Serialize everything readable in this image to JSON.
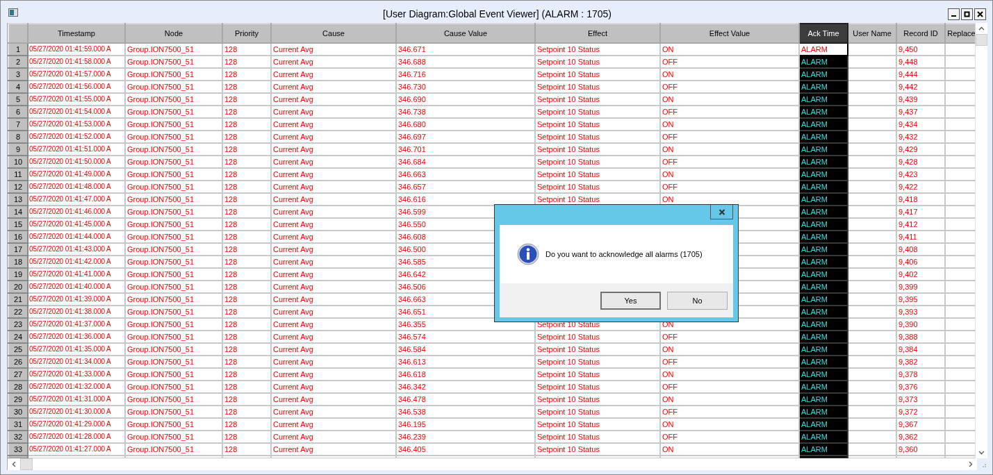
{
  "window": {
    "title": "[User Diagram:Global Event Viewer] (ALARM : 1705)"
  },
  "table": {
    "columns": [
      {
        "label": "Timestamp",
        "selected": false
      },
      {
        "label": "Node",
        "selected": false
      },
      {
        "label": "Priority",
        "selected": false
      },
      {
        "label": "Cause",
        "selected": false
      },
      {
        "label": "Cause Value",
        "selected": false
      },
      {
        "label": "Effect",
        "selected": false
      },
      {
        "label": "Effect Value",
        "selected": false
      },
      {
        "label": "Ack Time",
        "selected": true
      },
      {
        "label": "User Name",
        "selected": false
      },
      {
        "label": "Record ID",
        "selected": false
      },
      {
        "label": "Replace",
        "selected": false
      }
    ],
    "rows": [
      {
        "number": "1",
        "timestamp": "05/27/2020 01:41:59.000 A",
        "node": "Group.ION7500_51",
        "priority": "128",
        "cause": "Current Avg",
        "cause_value": "346.671",
        "effect": "Setpoint 10 Status",
        "effect_value": "ON",
        "ack_time": "ALARM",
        "selected": true,
        "record_id": "9,450"
      },
      {
        "number": "2",
        "timestamp": "05/27/2020 01:41:58.000 A",
        "node": "Group.ION7500_51",
        "priority": "128",
        "cause": "Current Avg",
        "cause_value": "346.688",
        "effect": "Setpoint 10 Status",
        "effect_value": "OFF",
        "ack_time": "ALARM",
        "selected": false,
        "record_id": "9,448"
      },
      {
        "number": "3",
        "timestamp": "05/27/2020 01:41:57.000 A",
        "node": "Group.ION7500_51",
        "priority": "128",
        "cause": "Current Avg",
        "cause_value": "346.716",
        "effect": "Setpoint 10 Status",
        "effect_value": "ON",
        "ack_time": "ALARM",
        "selected": false,
        "record_id": "9,444"
      },
      {
        "number": "4",
        "timestamp": "05/27/2020 01:41:56.000 A",
        "node": "Group.ION7500_51",
        "priority": "128",
        "cause": "Current Avg",
        "cause_value": "346.730",
        "effect": "Setpoint 10 Status",
        "effect_value": "OFF",
        "ack_time": "ALARM",
        "selected": false,
        "record_id": "9,442"
      },
      {
        "number": "5",
        "timestamp": "05/27/2020 01:41:55.000 A",
        "node": "Group.ION7500_51",
        "priority": "128",
        "cause": "Current Avg",
        "cause_value": "346.690",
        "effect": "Setpoint 10 Status",
        "effect_value": "ON",
        "ack_time": "ALARM",
        "selected": false,
        "record_id": "9,439"
      },
      {
        "number": "6",
        "timestamp": "05/27/2020 01:41:54.000 A",
        "node": "Group.ION7500_51",
        "priority": "128",
        "cause": "Current Avg",
        "cause_value": "346.738",
        "effect": "Setpoint 10 Status",
        "effect_value": "OFF",
        "ack_time": "ALARM",
        "selected": false,
        "record_id": "9,437"
      },
      {
        "number": "7",
        "timestamp": "05/27/2020 01:41:53.000 A",
        "node": "Group.ION7500_51",
        "priority": "128",
        "cause": "Current Avg",
        "cause_value": "346.680",
        "effect": "Setpoint 10 Status",
        "effect_value": "ON",
        "ack_time": "ALARM",
        "selected": false,
        "record_id": "9,434"
      },
      {
        "number": "8",
        "timestamp": "05/27/2020 01:41:52.000 A",
        "node": "Group.ION7500_51",
        "priority": "128",
        "cause": "Current Avg",
        "cause_value": "346.697",
        "effect": "Setpoint 10 Status",
        "effect_value": "OFF",
        "ack_time": "ALARM",
        "selected": false,
        "record_id": "9,432"
      },
      {
        "number": "9",
        "timestamp": "05/27/2020 01:41:51.000 A",
        "node": "Group.ION7500_51",
        "priority": "128",
        "cause": "Current Avg",
        "cause_value": "346.701",
        "effect": "Setpoint 10 Status",
        "effect_value": "ON",
        "ack_time": "ALARM",
        "selected": false,
        "record_id": "9,429"
      },
      {
        "number": "10",
        "timestamp": "05/27/2020 01:41:50.000 A",
        "node": "Group.ION7500_51",
        "priority": "128",
        "cause": "Current Avg",
        "cause_value": "346.684",
        "effect": "Setpoint 10 Status",
        "effect_value": "OFF",
        "ack_time": "ALARM",
        "selected": false,
        "record_id": "9,428"
      },
      {
        "number": "11",
        "timestamp": "05/27/2020 01:41:49.000 A",
        "node": "Group.ION7500_51",
        "priority": "128",
        "cause": "Current Avg",
        "cause_value": "346.663",
        "effect": "Setpoint 10 Status",
        "effect_value": "ON",
        "ack_time": "ALARM",
        "selected": false,
        "record_id": "9,423"
      },
      {
        "number": "12",
        "timestamp": "05/27/2020 01:41:48.000 A",
        "node": "Group.ION7500_51",
        "priority": "128",
        "cause": "Current Avg",
        "cause_value": "346.657",
        "effect": "Setpoint 10 Status",
        "effect_value": "OFF",
        "ack_time": "ALARM",
        "selected": false,
        "record_id": "9,422"
      },
      {
        "number": "13",
        "timestamp": "05/27/2020 01:41:47.000 A",
        "node": "Group.ION7500_51",
        "priority": "128",
        "cause": "Current Avg",
        "cause_value": "346.616",
        "effect": "Setpoint 10 Status",
        "effect_value": "ON",
        "ack_time": "ALARM",
        "selected": false,
        "record_id": "9,418"
      },
      {
        "number": "14",
        "timestamp": "05/27/2020 01:41:46.000 A",
        "node": "Group.ION7500_51",
        "priority": "128",
        "cause": "Current Avg",
        "cause_value": "346.599",
        "ack_time": "ALARM",
        "selected": false,
        "record_id": "9,417"
      },
      {
        "number": "15",
        "timestamp": "05/27/2020 01:41:45.000 A",
        "node": "Group.ION7500_51",
        "priority": "128",
        "cause": "Current Avg",
        "cause_value": "346.550",
        "ack_time": "ALARM",
        "selected": false,
        "record_id": "9,412"
      },
      {
        "number": "16",
        "timestamp": "05/27/2020 01:41:44.000 A",
        "node": "Group.ION7500_51",
        "priority": "128",
        "cause": "Current Avg",
        "cause_value": "346.608",
        "ack_time": "ALARM",
        "selected": false,
        "record_id": "9,411"
      },
      {
        "number": "17",
        "timestamp": "05/27/2020 01:41:43.000 A",
        "node": "Group.ION7500_51",
        "priority": "128",
        "cause": "Current Avg",
        "cause_value": "346.500",
        "ack_time": "ALARM",
        "selected": false,
        "record_id": "9,408"
      },
      {
        "number": "18",
        "timestamp": "05/27/2020 01:41:42.000 A",
        "node": "Group.ION7500_51",
        "priority": "128",
        "cause": "Current Avg",
        "cause_value": "346.585",
        "ack_time": "ALARM",
        "selected": false,
        "record_id": "9,406"
      },
      {
        "number": "19",
        "timestamp": "05/27/2020 01:41:41.000 A",
        "node": "Group.ION7500_51",
        "priority": "128",
        "cause": "Current Avg",
        "cause_value": "346.642",
        "ack_time": "ALARM",
        "selected": false,
        "record_id": "9,402"
      },
      {
        "number": "20",
        "timestamp": "05/27/2020 01:41:40.000 A",
        "node": "Group.ION7500_51",
        "priority": "128",
        "cause": "Current Avg",
        "cause_value": "346.506",
        "ack_time": "ALARM",
        "selected": false,
        "record_id": "9,399"
      },
      {
        "number": "21",
        "timestamp": "05/27/2020 01:41:39.000 A",
        "node": "Group.ION7500_51",
        "priority": "128",
        "cause": "Current Avg",
        "cause_value": "346.663",
        "ack_time": "ALARM",
        "selected": false,
        "record_id": "9,395"
      },
      {
        "number": "22",
        "timestamp": "05/27/2020 01:41:38.000 A",
        "node": "Group.ION7500_51",
        "priority": "128",
        "cause": "Current Avg",
        "cause_value": "346.651",
        "ack_time": "ALARM",
        "selected": false,
        "record_id": "9,393"
      },
      {
        "number": "23",
        "timestamp": "05/27/2020 01:41:37.000 A",
        "node": "Group.ION7500_51",
        "priority": "128",
        "cause": "Current Avg",
        "cause_value": "346.355",
        "effect": "Setpoint 10 Status",
        "effect_value": "ON",
        "ack_time": "ALARM",
        "selected": false,
        "record_id": "9,390"
      },
      {
        "number": "24",
        "timestamp": "05/27/2020 01:41:36.000 A",
        "node": "Group.ION7500_51",
        "priority": "128",
        "cause": "Current Avg",
        "cause_value": "346.574",
        "effect": "Setpoint 10 Status",
        "effect_value": "OFF",
        "ack_time": "ALARM",
        "selected": false,
        "record_id": "9,388"
      },
      {
        "number": "25",
        "timestamp": "05/27/2020 01:41:35.000 A",
        "node": "Group.ION7500_51",
        "priority": "128",
        "cause": "Current Avg",
        "cause_value": "346.584",
        "effect": "Setpoint 10 Status",
        "effect_value": "ON",
        "ack_time": "ALARM",
        "selected": false,
        "record_id": "9,384"
      },
      {
        "number": "26",
        "timestamp": "05/27/2020 01:41:34.000 A",
        "node": "Group.ION7500_51",
        "priority": "128",
        "cause": "Current Avg",
        "cause_value": "346.613",
        "effect": "Setpoint 10 Status",
        "effect_value": "OFF",
        "ack_time": "ALARM",
        "selected": false,
        "record_id": "9,382"
      },
      {
        "number": "27",
        "timestamp": "05/27/2020 01:41:33.000 A",
        "node": "Group.ION7500_51",
        "priority": "128",
        "cause": "Current Avg",
        "cause_value": "346.618",
        "effect": "Setpoint 10 Status",
        "effect_value": "ON",
        "ack_time": "ALARM",
        "selected": false,
        "record_id": "9,378"
      },
      {
        "number": "28",
        "timestamp": "05/27/2020 01:41:32.000 A",
        "node": "Group.ION7500_51",
        "priority": "128",
        "cause": "Current Avg",
        "cause_value": "346.342",
        "effect": "Setpoint 10 Status",
        "effect_value": "OFF",
        "ack_time": "ALARM",
        "selected": false,
        "record_id": "9,376"
      },
      {
        "number": "29",
        "timestamp": "05/27/2020 01:41:31.000 A",
        "node": "Group.ION7500_51",
        "priority": "128",
        "cause": "Current Avg",
        "cause_value": "346.478",
        "effect": "Setpoint 10 Status",
        "effect_value": "ON",
        "ack_time": "ALARM",
        "selected": false,
        "record_id": "9,373"
      },
      {
        "number": "30",
        "timestamp": "05/27/2020 01:41:30.000 A",
        "node": "Group.ION7500_51",
        "priority": "128",
        "cause": "Current Avg",
        "cause_value": "346.538",
        "effect": "Setpoint 10 Status",
        "effect_value": "OFF",
        "ack_time": "ALARM",
        "selected": false,
        "record_id": "9,372"
      },
      {
        "number": "31",
        "timestamp": "05/27/2020 01:41:29.000 A",
        "node": "Group.ION7500_51",
        "priority": "128",
        "cause": "Current Avg",
        "cause_value": "346.195",
        "effect": "Setpoint 10 Status",
        "effect_value": "ON",
        "ack_time": "ALARM",
        "selected": false,
        "record_id": "9,367"
      },
      {
        "number": "32",
        "timestamp": "05/27/2020 01:41:28.000 A",
        "node": "Group.ION7500_51",
        "priority": "128",
        "cause": "Current Avg",
        "cause_value": "346.239",
        "effect": "Setpoint 10 Status",
        "effect_value": "OFF",
        "ack_time": "ALARM",
        "selected": false,
        "record_id": "9,362"
      },
      {
        "number": "33",
        "timestamp": "05/27/2020 01:41:27.000 A",
        "node": "Group.ION7500_51",
        "priority": "128",
        "cause": "Current Avg",
        "cause_value": "346.405",
        "effect": "Setpoint 10 Status",
        "effect_value": "ON",
        "ack_time": "ALARM",
        "selected": false,
        "record_id": "9,360"
      }
    ]
  },
  "dialog": {
    "message": "Do you want to acknowledge all alarms (1705)",
    "buttons": [
      "Yes",
      "No"
    ]
  }
}
